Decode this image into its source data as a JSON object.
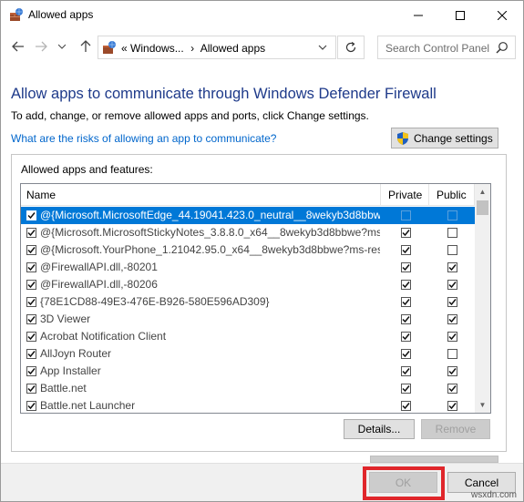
{
  "window": {
    "title": "Allowed apps"
  },
  "nav": {
    "breadcrumb_prefix": "«",
    "breadcrumb_parent": "Windows...",
    "breadcrumb_sep": "›",
    "breadcrumb_current": "Allowed apps"
  },
  "search": {
    "placeholder": "Search Control Panel"
  },
  "content": {
    "heading": "Allow apps to communicate through Windows Defender Firewall",
    "subtext": "To add, change, or remove allowed apps and ports, click Change settings.",
    "risk_link": "What are the risks of allowing an app to communicate?",
    "change_settings_label": "Change settings",
    "group_label": "Allowed apps and features:"
  },
  "list": {
    "columns": {
      "name": "Name",
      "private": "Private",
      "public": "Public"
    },
    "rows": [
      {
        "name": "@{Microsoft.MicrosoftEdge_44.19041.423.0_neutral__8wekyb3d8bbw...",
        "enabled": true,
        "private": false,
        "public": false,
        "selected": true
      },
      {
        "name": "@{Microsoft.MicrosoftStickyNotes_3.8.8.0_x64__8wekyb3d8bbwe?ms...",
        "enabled": true,
        "private": true,
        "public": false,
        "selected": false
      },
      {
        "name": "@{Microsoft.YourPhone_1.21042.95.0_x64__8wekyb3d8bbwe?ms-res...",
        "enabled": true,
        "private": true,
        "public": false,
        "selected": false
      },
      {
        "name": "@FirewallAPI.dll,-80201",
        "enabled": true,
        "private": true,
        "public": true,
        "selected": false
      },
      {
        "name": "@FirewallAPI.dll,-80206",
        "enabled": true,
        "private": true,
        "public": true,
        "selected": false
      },
      {
        "name": "{78E1CD88-49E3-476E-B926-580E596AD309}",
        "enabled": true,
        "private": true,
        "public": true,
        "selected": false
      },
      {
        "name": "3D Viewer",
        "enabled": true,
        "private": true,
        "public": true,
        "selected": false
      },
      {
        "name": "Acrobat Notification Client",
        "enabled": true,
        "private": true,
        "public": true,
        "selected": false
      },
      {
        "name": "AllJoyn Router",
        "enabled": true,
        "private": true,
        "public": false,
        "selected": false
      },
      {
        "name": "App Installer",
        "enabled": true,
        "private": true,
        "public": true,
        "selected": false
      },
      {
        "name": "Battle.net",
        "enabled": true,
        "private": true,
        "public": true,
        "selected": false
      },
      {
        "name": "Battle.net Launcher",
        "enabled": true,
        "private": true,
        "public": true,
        "selected": false
      }
    ]
  },
  "buttons": {
    "details": "Details...",
    "remove": "Remove",
    "ok": "OK",
    "cancel": "Cancel"
  },
  "watermark": "wsxdn.com",
  "colors": {
    "heading": "#1e3a8a",
    "link": "#0066cc",
    "selection": "#0078d7",
    "highlight_outline": "#e0262b"
  }
}
